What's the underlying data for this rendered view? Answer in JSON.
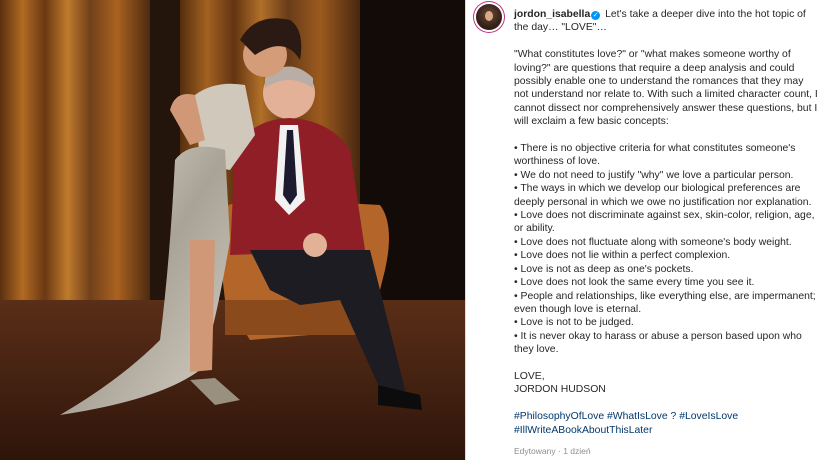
{
  "post": {
    "photo_alt_icon": "photo",
    "username": "jordon_isabella",
    "verified_icon": "verified-badge-icon",
    "intro": "Let's take a deeper dive into the hot topic of the day… \"LOVE\"…",
    "question": "\"What constitutes love?\" or \"what makes someone worthy of loving?\" are questions that require a deep analysis and could possibly enable one to understand the romances that they may not understand nor relate to. With such a limited character count, I cannot dissect nor comprehensively answer these questions, but I will exclaim a few basic concepts:",
    "bullets": [
      "• There is no objective criteria for what constitutes someone's worthiness of love.",
      "• We do not need to justify \"why\" we love a particular person.",
      "• The ways in which we develop our biological preferences are deeply personal in which we owe no justification nor explanation.",
      "• Love does not discriminate against sex, skin-color, religion, age, or ability.",
      "• Love does not fluctuate along with someone's body weight.",
      "• Love does not lie within a perfect complexion.",
      "• Love is not as deep as one's pockets.",
      "• Love does not look the same every time you see it.",
      "• People and relationships, like everything else, are impermanent; even though love is eternal.",
      "• Love is not to be judged.",
      "• It is never okay to harass or abuse a person based upon who they love."
    ],
    "signoff": "LOVE,",
    "signature": "JORDON HUDSON",
    "hashtags_line1": "#PhilosophyOfLove #WhatIsLove ? #LoveIsLove",
    "hashtags_line2": "#IllWriteABookAboutThisLater",
    "edited": "Edytowany",
    "dot": "·",
    "time": "1 dzień"
  }
}
